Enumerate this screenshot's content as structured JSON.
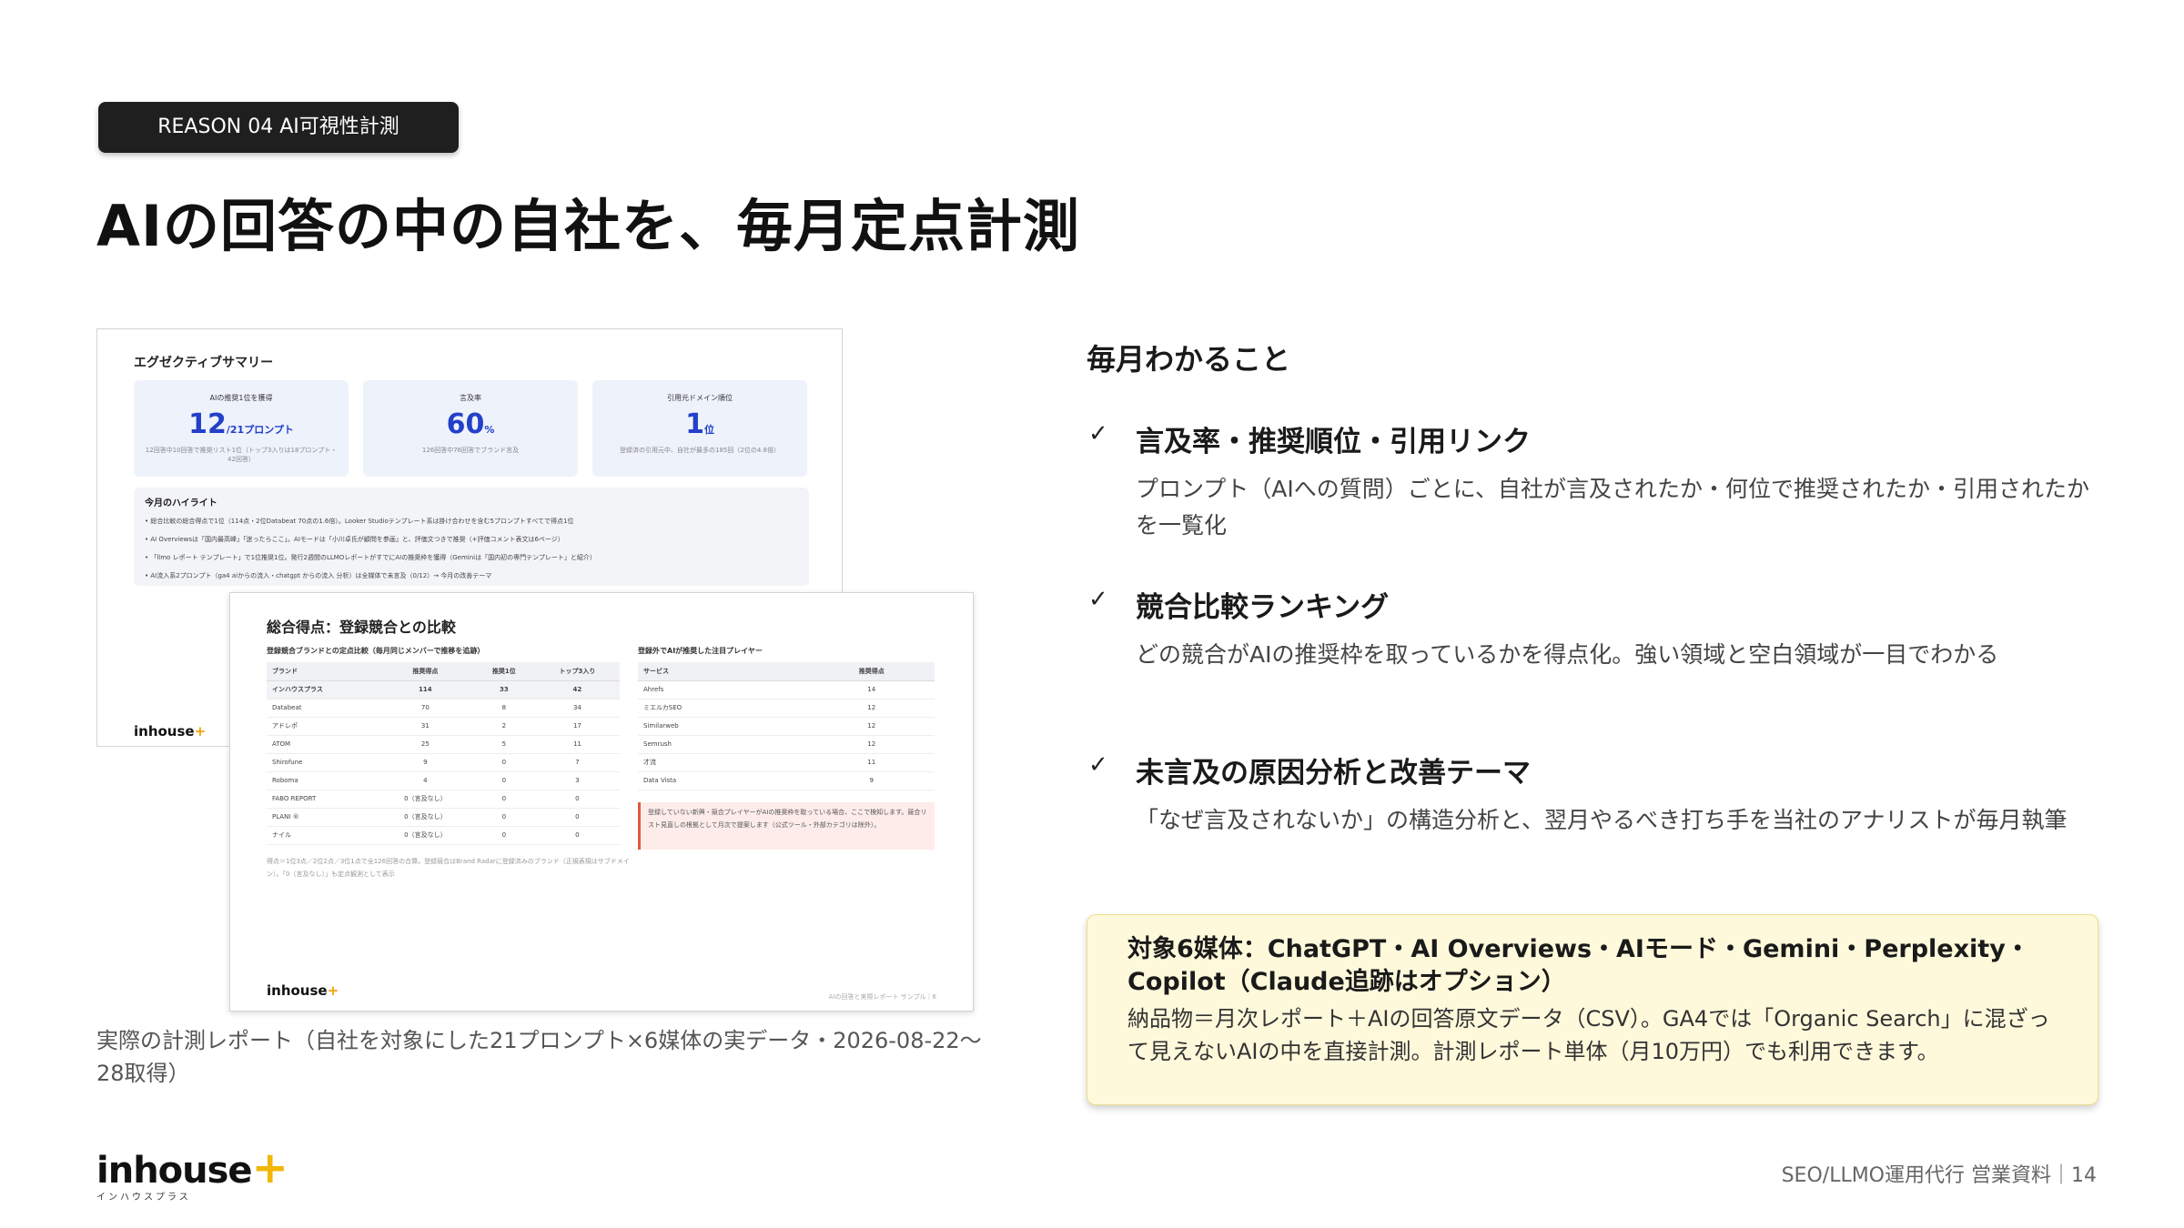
{
  "header": {
    "badge": "REASON 04 AI可視性計測",
    "title": "AIの回答の中の自社を、毎月定点計測"
  },
  "report_back": {
    "title": "エグゼクティブサマリー",
    "kpis": [
      {
        "label": "AIの推奨1位を獲得",
        "value": "12",
        "unit": "/21プロンプト",
        "sub": "12回答中10回答で推奨リスト1位（トップ3入りは18プロンプト・42回答）"
      },
      {
        "label": "言及率",
        "value": "60",
        "unit": "%",
        "sub": "126回答中76回答でブランド言及"
      },
      {
        "label": "引用元ドメイン順位",
        "value": "1",
        "unit": "位",
        "sub": "登録済の引用元中、自社が最多の185回（2位の4.8倍）"
      }
    ],
    "highlights_title": "今月のハイライト",
    "highlights": [
      "• 総合比較の総合得点で1位（114点・2位Databeat 70点の1.6倍）。Looker Studioテンプレート系は掛け合わせを含む5プロンプトすべてで得点1位",
      "• AI Overviewsは「国内最高峰」「迷ったらここ」。AIモードは「小川卓氏が顧問を参画」と、評価文つきで推奨（+評価コメント表文は6ページ）",
      "• 「llmo レポート テンプレート」で1位推奨1位。発行2週間のLLMOレポートがすでにAIの推奨枠を獲得（Geminiは「国内初の専門テンプレート」と紹介）",
      "• AI流入系2プロンプト（ga4 aiからの流入・chatgpt からの流入 分析）は全媒体で未言及（0/12）→ 今月の改善テーマ"
    ],
    "logo": "inhouse"
  },
  "report_front": {
    "title": "総合得点：登録競合との比較",
    "left_heading": "登録競合ブランドとの定点比較（毎月同じメンバーで推移を追跡）",
    "left_columns": [
      "ブランド",
      "推奨得点",
      "推奨1位",
      "トップ3入り"
    ],
    "left_rows": [
      [
        "インハウスプラス",
        "114",
        "33",
        "42"
      ],
      [
        "Databeat",
        "70",
        "8",
        "34"
      ],
      [
        "アドレポ",
        "31",
        "2",
        "17"
      ],
      [
        "ATOM",
        "25",
        "5",
        "11"
      ],
      [
        "Shirofune",
        "9",
        "0",
        "7"
      ],
      [
        "Roboma",
        "4",
        "0",
        "3"
      ],
      [
        "FABO REPORT",
        "0（言及なし）",
        "0",
        "0"
      ],
      [
        "PLANI ®",
        "0（言及なし）",
        "0",
        "0"
      ],
      [
        "ナイル",
        "0（言及なし）",
        "0",
        "0"
      ]
    ],
    "right_heading": "登録外でAIが推奨した注目プレイヤー",
    "right_columns": [
      "サービス",
      "推奨得点"
    ],
    "right_rows": [
      [
        "Ahrefs",
        "14"
      ],
      [
        "ミエルカSEO",
        "12"
      ],
      [
        "Similarweb",
        "12"
      ],
      [
        "Semrush",
        "12"
      ],
      [
        "才流",
        "11"
      ],
      [
        "Data Vista",
        "9"
      ]
    ],
    "note": "登録していない新興・競合プレイヤーがAIの推奨枠を取っている場合、ここで検知します。競合リスト見直しの根拠として月次で提案します（公式ツール・外部カテゴリは除外）。",
    "footnote": "得点＝1位3点／2位2点／3位1点で全126回答の合算。登録競合はBrand Radarに登録済みのブランド（正規表現はサブドメイン）。「0（言及なし）」も定点観測として表示",
    "logo": "inhouse",
    "foot_right": "AIの回答と実際レポート サンプル｜6"
  },
  "caption": "実際の計測レポート（自社を対象にした21プロンプト×6媒体の実データ・2026-08-22〜28取得）",
  "right": {
    "heading": "毎月わかること",
    "items": [
      {
        "check": "✓",
        "title": "言及率・推奨順位・引用リンク",
        "desc": "プロンプト（AIへの質問）ごとに、自社が言及されたか・何位で推奨されたか・引用されたかを一覧化"
      },
      {
        "check": "✓",
        "title": "競合比較ランキング",
        "desc": "どの競合がAIの推奨枠を取っているかを得点化。強い領域と空白領域が一目でわかる"
      },
      {
        "check": "✓",
        "title": "未言及の原因分析と改善テーマ",
        "desc": "「なぜ言及されないか」の構造分析と、翌月やるべき打ち手を当社のアナリストが毎月執筆"
      }
    ],
    "info_title": "対象6媒体：ChatGPT・AI Overviews・AIモード・Gemini・Perplexity・Copilot（Claude追跡はオプション）",
    "info_body": "納品物＝月次レポート＋AIの回答原文データ（CSV）。GA4では「Organic Search」に混ざって見えないAIの中を直接計測。計測レポート単体（月10万円）でも利用できます。"
  },
  "footer": {
    "logo": "inhouse",
    "logo_plus": "+",
    "logo_sub": "インハウスプラス",
    "page": "SEO/LLMO運用代行 営業資料｜14",
    "accent": "#f2b705"
  }
}
